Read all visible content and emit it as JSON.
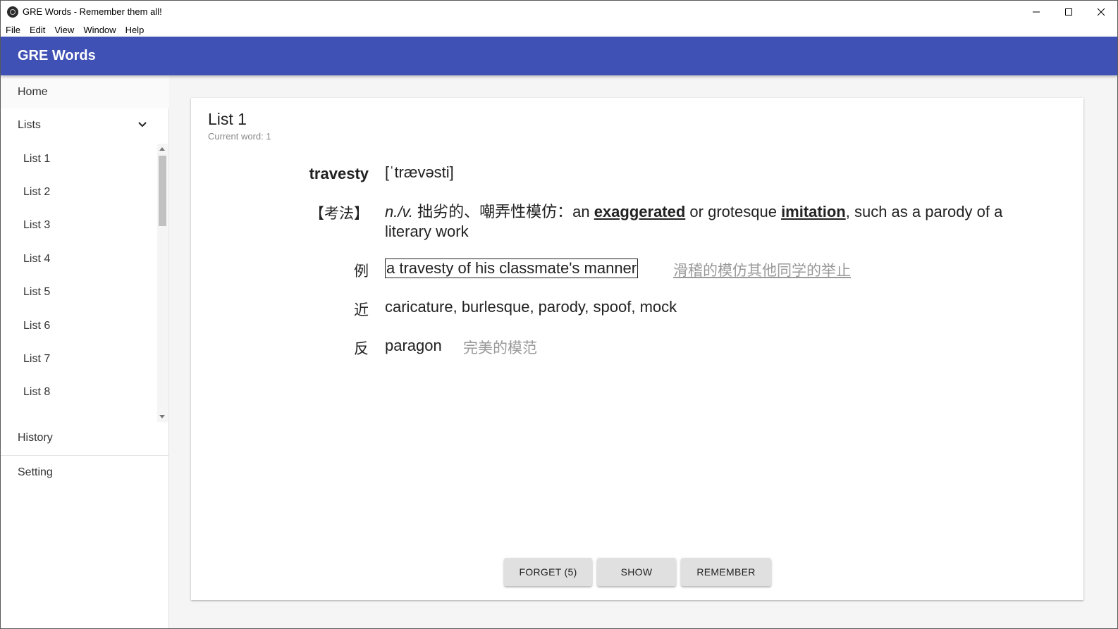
{
  "window": {
    "title": "GRE Words - Remember them all!"
  },
  "menu": [
    "File",
    "Edit",
    "View",
    "Window",
    "Help"
  ],
  "appbar": {
    "title": "GRE Words"
  },
  "sidebar": {
    "home": "Home",
    "lists": "Lists",
    "list_items": [
      "List 1",
      "List 2",
      "List 3",
      "List 4",
      "List 5",
      "List 6",
      "List 7",
      "List 8"
    ],
    "history": "History",
    "setting": "Setting"
  },
  "card": {
    "title": "List 1",
    "subtitle": "Current word: 1",
    "word": "travesty",
    "phonetic": "[ˈtrævəsti]",
    "kaofa_label": "【考法】",
    "pos": "n./v.",
    "def_cn": "拙劣的、嘲弄性模仿：",
    "def_pre": "an ",
    "def_kw1": "exaggerated",
    "def_mid": " or grotesque ",
    "def_kw2": "imitation",
    "def_post": ", such as a parody of a literary work",
    "example_label": "例",
    "example_en": "a travesty of his classmate's manner",
    "example_cn": "滑稽的模仿其他同学的举止",
    "synonym_label": "近",
    "synonyms": "caricature, burlesque, parody, spoof, mock",
    "antonym_label": "反",
    "antonym_en": "paragon",
    "antonym_cn": "完美的模范"
  },
  "buttons": {
    "forget": "FORGET (5)",
    "show": "SHOW",
    "remember": "REMEMBER"
  },
  "colors": {
    "appbar": "#3f51b5"
  }
}
